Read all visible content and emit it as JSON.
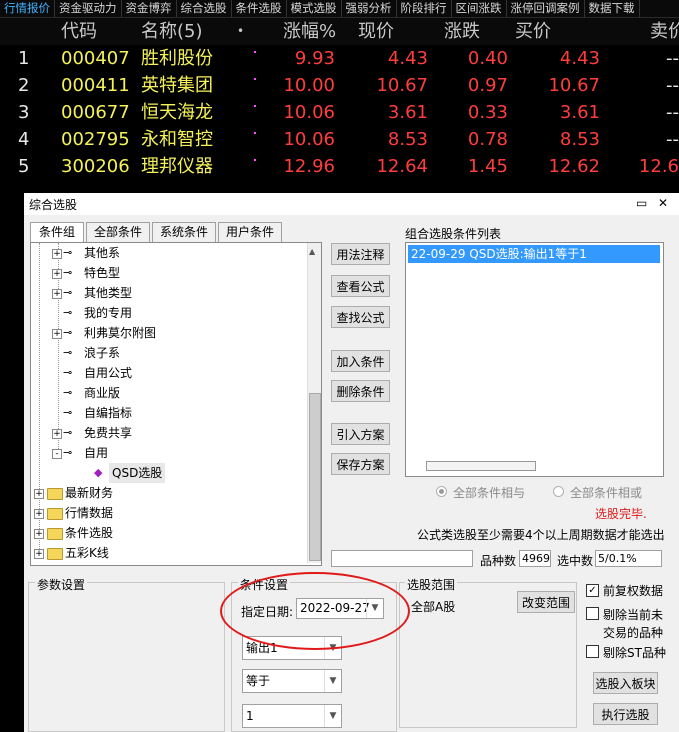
{
  "top_tabs": [
    "行情报价",
    "资金驱动力",
    "资金博弈",
    "综合选股",
    "条件选股",
    "模式选股",
    "强弱分析",
    "阶段排行",
    "区间涨跌",
    "涨停回调案例",
    "数据下载"
  ],
  "quote_table": {
    "headers": [
      "",
      "代码",
      "名称(5)",
      "涨幅%",
      "现价",
      "涨跌",
      "买价",
      "卖价"
    ],
    "header_suffix": "•",
    "rows": [
      {
        "no": "1",
        "code": "000407",
        "name": "胜利股份",
        "pct": "9.93",
        "price": "4.43",
        "chg": "0.40",
        "bid": "4.43",
        "ask": "--"
      },
      {
        "no": "2",
        "code": "000411",
        "name": "英特集团",
        "pct": "10.00",
        "price": "10.67",
        "chg": "0.97",
        "bid": "10.67",
        "ask": "--"
      },
      {
        "no": "3",
        "code": "000677",
        "name": "恒天海龙",
        "pct": "10.06",
        "price": "3.61",
        "chg": "0.33",
        "bid": "3.61",
        "ask": "--"
      },
      {
        "no": "4",
        "code": "002795",
        "name": "永和智控",
        "pct": "10.06",
        "price": "8.53",
        "chg": "0.78",
        "bid": "8.53",
        "ask": "--"
      },
      {
        "no": "5",
        "code": "300206",
        "name": "理邦仪器",
        "pct": "12.96",
        "price": "12.64",
        "chg": "1.45",
        "bid": "12.62",
        "ask": "12.6"
      }
    ]
  },
  "dialog": {
    "title": "综合选股",
    "left_tabs": [
      "条件组",
      "全部条件",
      "系统条件",
      "用户条件"
    ],
    "tree": [
      {
        "label": "其他系",
        "type": "key",
        "expand": "+"
      },
      {
        "label": "特色型",
        "type": "key",
        "expand": "+"
      },
      {
        "label": "其他类型",
        "type": "key",
        "expand": "+"
      },
      {
        "label": "我的专用",
        "type": "key",
        "expand": ""
      },
      {
        "label": "利弗莫尔附图",
        "type": "key",
        "expand": "+"
      },
      {
        "label": "浪子系",
        "type": "key",
        "expand": ""
      },
      {
        "label": "自用公式",
        "type": "key",
        "expand": ""
      },
      {
        "label": "商业版",
        "type": "key",
        "expand": ""
      },
      {
        "label": "自编指标",
        "type": "key",
        "expand": ""
      },
      {
        "label": "免费共享",
        "type": "key",
        "expand": "+"
      },
      {
        "label": "自用",
        "type": "key",
        "expand": "-"
      },
      {
        "label": "QSD选股",
        "type": "item",
        "expand": ""
      },
      {
        "label": "最新财务",
        "type": "folder",
        "expand": "+"
      },
      {
        "label": "行情数据",
        "type": "folder",
        "expand": "+"
      },
      {
        "label": "条件选股",
        "type": "folder",
        "expand": "+"
      },
      {
        "label": "五彩K线",
        "type": "folder",
        "expand": "+"
      }
    ],
    "mid_buttons": [
      "用法注释",
      "查看公式",
      "查找公式",
      "加入条件",
      "删除条件",
      "引入方案",
      "保存方案"
    ],
    "combo_list_label": "组合选股条件列表",
    "combo_list_items": [
      "22-09-29 QSD选股:输出1等于1"
    ],
    "radio_and": "全部条件相与",
    "radio_or": "全部条件相或",
    "status_done": "选股完毕.",
    "formula_note": "公式类选股至少需要4个以上周期数据才能选出",
    "count_label": "品种数",
    "count_value": "4969",
    "selected_label": "选中数",
    "selected_value": "5/0.1%",
    "param_group": "参数设置",
    "cond_group": "条件设置",
    "date_label": "指定日期:",
    "date_value": "2022-09-27",
    "output_value": "输出1",
    "op_value": "等于",
    "num_value": "1",
    "range_group": "选股范围",
    "range_value": "全部A股",
    "change_range": "改变范围",
    "chk_fq": "前复权数据",
    "chk_remove1": "剔除当前未",
    "chk_remove1b": "交易的品种",
    "chk_st": "剔除ST品种",
    "btn_board": "选股入板块",
    "btn_exec": "执行选股"
  },
  "colors": {
    "accent_red": "#e01a1a",
    "quote_red": "#ff3d3d",
    "quote_yellow": "#f4f15a",
    "selection_blue": "#3399ff"
  }
}
